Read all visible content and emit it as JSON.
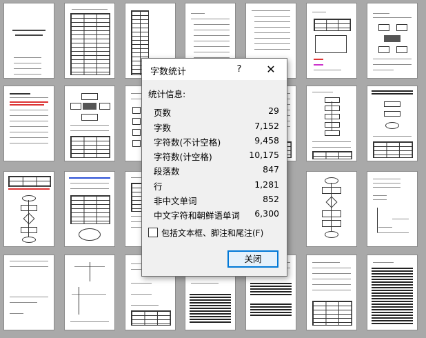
{
  "dialog": {
    "title": "字数统计",
    "help_label": "?",
    "close_glyph": "✕",
    "stats_header": "统计信息:",
    "stats": [
      {
        "label": "页数",
        "value": "29"
      },
      {
        "label": "字数",
        "value": "7,152"
      },
      {
        "label": "字符数(不计空格)",
        "value": "9,458"
      },
      {
        "label": "字符数(计空格)",
        "value": "10,175"
      },
      {
        "label": "段落数",
        "value": "847"
      },
      {
        "label": "行",
        "value": "1,281"
      },
      {
        "label": "非中文单词",
        "value": "852"
      },
      {
        "label": "中文字符和朝鲜语单词",
        "value": "6,300"
      }
    ],
    "include_checkbox": {
      "label": "包括文本框、脚注和尾注(F)",
      "checked": false
    },
    "close_button_label": "关闭"
  },
  "colors": {
    "accent": "#0078d7",
    "page_background": "#a9a9a9"
  }
}
